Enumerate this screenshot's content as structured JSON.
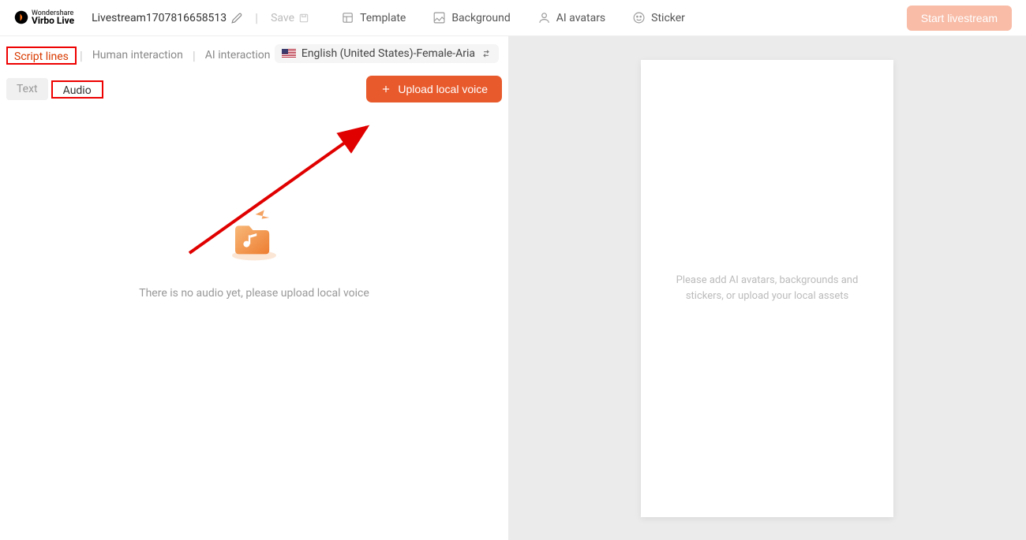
{
  "header": {
    "brand_top": "Wondershare",
    "brand_bottom": "Virbo Live",
    "stream_name": "Livestream1707816658513",
    "save_label": "Save",
    "nav": {
      "template": "Template",
      "background": "Background",
      "ai_avatars": "AI avatars",
      "sticker": "Sticker"
    },
    "start_label": "Start livestream"
  },
  "tabs1": {
    "script_lines": "Script lines",
    "human_interaction": "Human interaction",
    "ai_interaction": "AI interaction"
  },
  "language": "English (United States)-Female-Aria",
  "tabs2": {
    "text": "Text",
    "audio": "Audio"
  },
  "upload_label": "Upload local voice",
  "empty_state": "There is no audio yet, please upload local voice",
  "canvas_text": "Please add AI avatars, backgrounds and stickers, or upload your local assets",
  "annotation_arrow_color": "#e00000"
}
